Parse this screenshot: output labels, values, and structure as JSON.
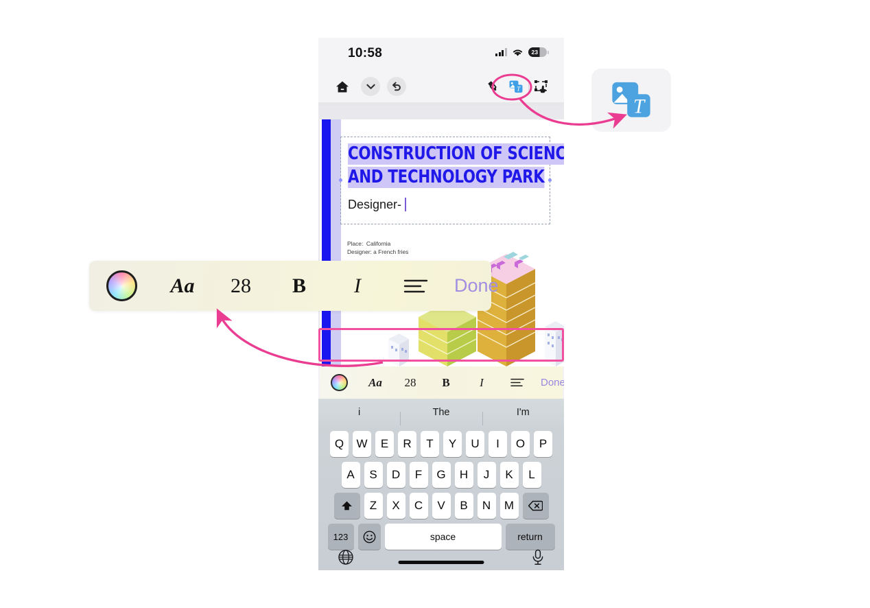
{
  "phone": {
    "status_bar": {
      "time": "10:58",
      "battery_level": "23",
      "signal_icon": "cellular-bars-icon",
      "wifi_icon": "wifi-icon",
      "battery_icon": "battery-icon"
    },
    "app_toolbar": {
      "home_icon": "home-icon",
      "chevron_icon": "chevron-down-icon",
      "undo_icon": "undo-icon",
      "pen_icon": "highlighter-pen-icon",
      "image_text_icon": "image-text-icon",
      "crop_select_icon": "crop-select-icon"
    },
    "document": {
      "title_line1": "CONSTRUCTION OF SCIENCE",
      "title_line2": "AND TECHNOLOGY PARK",
      "subtitle": "Designer-",
      "meta_line1": "Place:  California",
      "meta_line2": "Designer: a French fries",
      "title_color": "#1f18e8",
      "selection_color": "#cdc6f7",
      "accent_bar_color": "#1a16f0"
    },
    "format_toolbar": {
      "color_wheel": "color-wheel-icon",
      "font_label": "Aa",
      "font_size": "28",
      "bold_label": "B",
      "italic_label": "I",
      "align_icon": "text-align-left-icon",
      "done_label": "Done",
      "done_color": "#9a86e0",
      "highlight_color": "#f0509f"
    },
    "suggestions": [
      "i",
      "The",
      "I'm"
    ],
    "keyboard": {
      "row1": [
        "Q",
        "W",
        "E",
        "R",
        "T",
        "Y",
        "U",
        "I",
        "O",
        "P"
      ],
      "row2": [
        "A",
        "S",
        "D",
        "F",
        "G",
        "H",
        "J",
        "K",
        "L"
      ],
      "row3": [
        "Z",
        "X",
        "C",
        "V",
        "B",
        "N",
        "M"
      ],
      "shift_icon": "shift-icon",
      "backspace_icon": "backspace-icon",
      "numbers_key": "123",
      "emoji_icon": "emoji-icon",
      "space_key": "space",
      "return_key": "return",
      "globe_icon": "globe-icon",
      "mic_icon": "microphone-icon"
    }
  },
  "callouts": {
    "magnified_toolbar": {
      "color_wheel": "color-wheel-icon",
      "font_label": "Aa",
      "font_size": "28",
      "bold_label": "B",
      "italic_label": "I",
      "align_icon": "text-align-left-icon",
      "done_label": "Done"
    },
    "icon_zoom": {
      "icon": "image-text-icon",
      "icon_color": "#4da3e0"
    },
    "annotation_color": "#ea3d92"
  }
}
